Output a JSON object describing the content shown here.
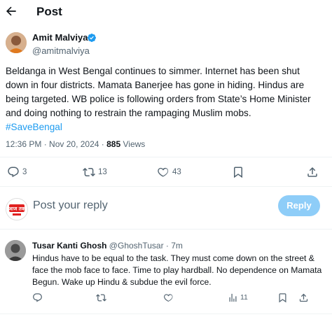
{
  "header": {
    "title": "Post"
  },
  "post": {
    "author_name": "Amit Malviya",
    "author_handle": "@amitmalviya",
    "text_lines": [
      "Beldanga in West Bengal continues to simmer. Internet has been shut",
      "down in four districts. Mamata Banerjee has gone in hiding. Hindus are",
      "being targeted. WB police is following orders from State’s Home Minister",
      "and doing nothing to restrain the rampaging Muslim mobs."
    ],
    "hashtag": "#SaveBengal",
    "time": "12:36 PM",
    "date": "Nov 20, 2024",
    "views_count": "885",
    "views_label": "Views",
    "replies": "3",
    "reposts": "13",
    "likes": "43"
  },
  "reply_box": {
    "placeholder": "Post your reply",
    "button_label": "Reply",
    "avatar_text": "आज तक"
  },
  "reply": {
    "author_name": "Tusar Kanti Ghosh",
    "author_handle": "@GhoshTusar",
    "time": "7m",
    "text": "Hindus have to be equal to the task. They must come down on the street & face the mob face to face. Time to play hardball. No dependence on Mamata Begun.  Wake up Hindu & subdue the evil force.",
    "views": "11"
  },
  "colors": {
    "accent": "#1d9bf0",
    "muted": "#536471",
    "reply_button": "#8ecdf8",
    "divider": "#eff3f4"
  }
}
